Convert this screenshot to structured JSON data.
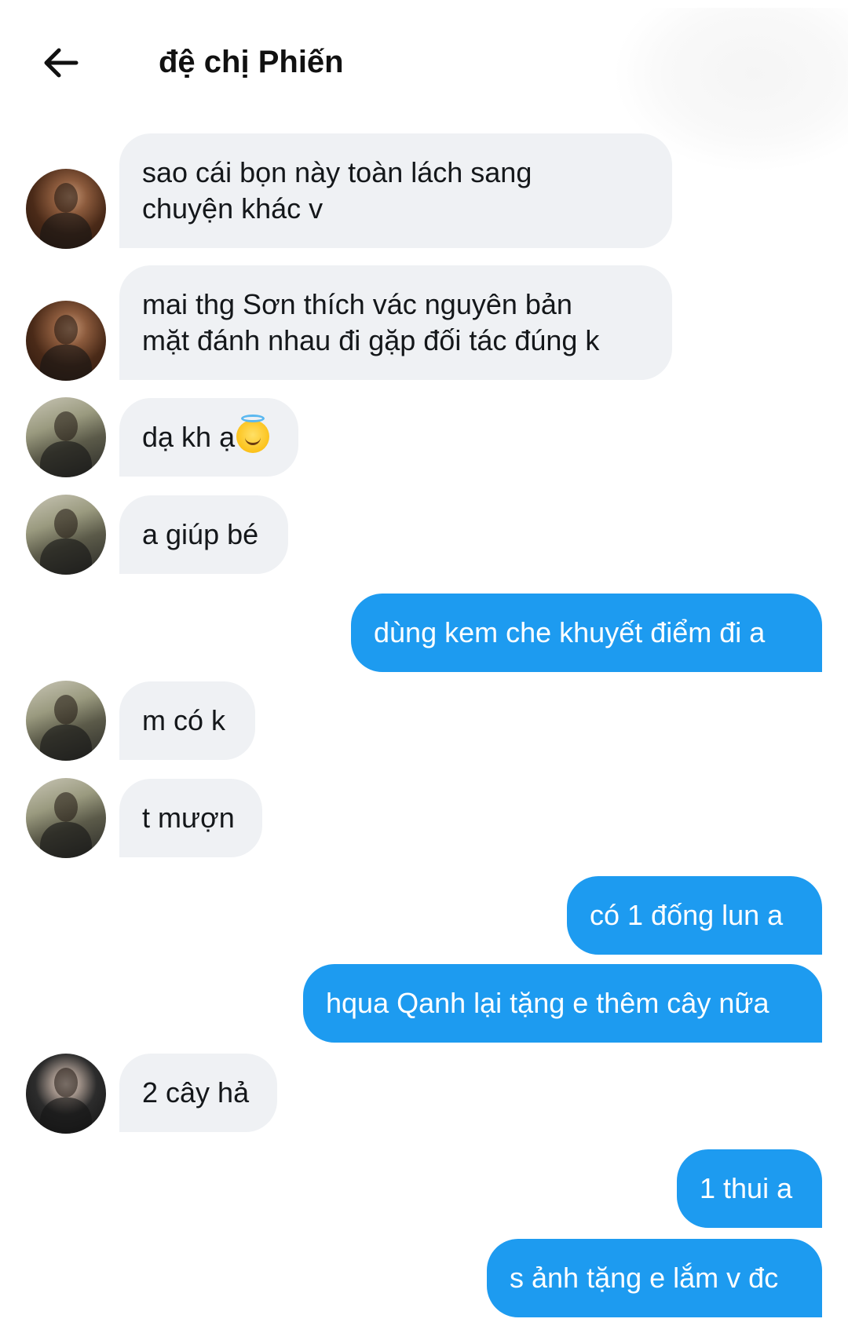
{
  "header": {
    "back_icon": "arrow-left-icon",
    "title": "đệ chị Phiến"
  },
  "colors": {
    "incoming_bubble": "#eff1f4",
    "outgoing_bubble": "#1d9bf0",
    "outgoing_text": "#ffffff"
  },
  "messages": [
    {
      "direction": "incoming",
      "avatar": "avatar-a",
      "lines": [
        "sao cái bọn này toàn lách sang",
        "chuyện khác v"
      ]
    },
    {
      "direction": "incoming",
      "avatar": "avatar-a",
      "lines": [
        "mai thg Sơn thích vác nguyên bản",
        "mặt đánh nhau đi gặp đối tác đúng k"
      ]
    },
    {
      "direction": "incoming",
      "avatar": "avatar-b",
      "lines": [
        "dạ kh ạ"
      ],
      "emoji": "smiling-face-with-halo"
    },
    {
      "direction": "incoming",
      "avatar": "avatar-b",
      "lines": [
        "a giúp bé"
      ]
    },
    {
      "direction": "outgoing",
      "lines": [
        "dùng kem che khuyết điểm đi a"
      ]
    },
    {
      "direction": "incoming",
      "avatar": "avatar-b",
      "lines": [
        "m có k"
      ]
    },
    {
      "direction": "incoming",
      "avatar": "avatar-b",
      "lines": [
        "t mượn"
      ]
    },
    {
      "direction": "outgoing",
      "lines": [
        "có 1 đống lun a"
      ]
    },
    {
      "direction": "outgoing",
      "lines": [
        "hqua Qanh lại tặng e thêm cây nữa"
      ]
    },
    {
      "direction": "incoming",
      "avatar": "avatar-c",
      "lines": [
        "2 cây hả"
      ]
    },
    {
      "direction": "outgoing",
      "lines": [
        "1 thui a"
      ]
    },
    {
      "direction": "outgoing",
      "lines": [
        "s ảnh tặng e lắm v đc"
      ]
    }
  ]
}
